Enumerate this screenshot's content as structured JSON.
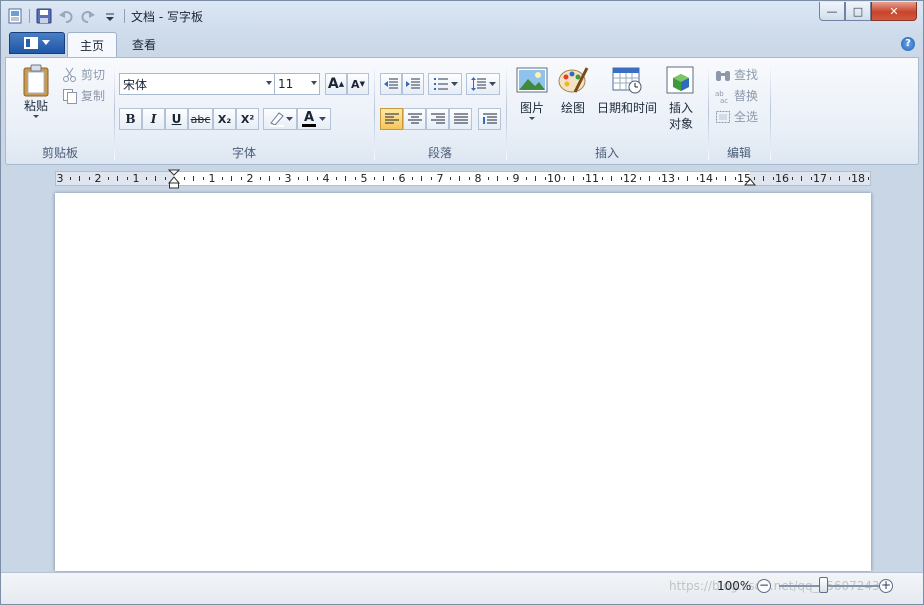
{
  "titlebar": {
    "title": "文档 - 写字板",
    "icons": [
      "wordpad-app-icon",
      "save-icon",
      "undo-icon",
      "redo-icon",
      "customize-qat-icon"
    ],
    "controls": {
      "minimize": "—",
      "maximize": "□",
      "close": "✕"
    }
  },
  "tabs": [
    {
      "label": "主页",
      "active": true
    },
    {
      "label": "查看",
      "active": false
    }
  ],
  "ribbon": {
    "clipboard": {
      "label": "剪贴板",
      "paste": "粘贴",
      "cut": "剪切",
      "copy": "复制"
    },
    "font": {
      "label": "字体",
      "family": "宋体",
      "size": "11",
      "grow": "A",
      "shrink": "A",
      "bold": "B",
      "italic": "I",
      "underline": "U",
      "strike": "abc",
      "sub": "X₂",
      "sup": "X²",
      "color_letter": "A",
      "font_color": "#000000",
      "highlight_color": "#ffffff"
    },
    "paragraph": {
      "label": "段落"
    },
    "insert": {
      "label": "插入",
      "picture": "图片",
      "paint": "绘图",
      "datetime": "日期和时间",
      "object_line1": "插入",
      "object_line2": "对象"
    },
    "edit": {
      "label": "编辑",
      "find": "查找",
      "replace": "替换",
      "select_all": "全选"
    }
  },
  "ruler": {
    "labels": [
      "3",
      "2",
      "1",
      "1",
      "2",
      "3",
      "4",
      "5",
      "6",
      "7",
      "8",
      "9",
      "10",
      "11",
      "12",
      "13",
      "14",
      "15",
      "16",
      "17",
      "18"
    ]
  },
  "status": {
    "zoom": "100%",
    "zoom_out": "−",
    "zoom_in": "+",
    "watermark": "https://blog.csdn.net/qq_35607243"
  }
}
